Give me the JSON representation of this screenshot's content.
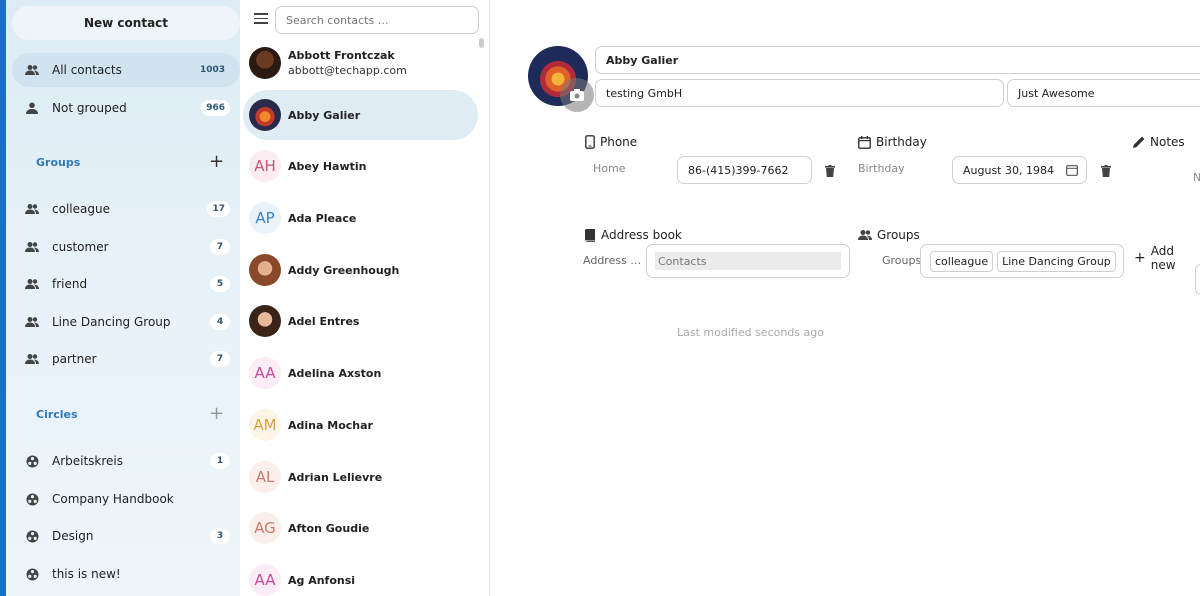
{
  "nav": {
    "new_contact": "New contact",
    "all_contacts": {
      "label": "All contacts",
      "count": "1003"
    },
    "not_grouped": {
      "label": "Not grouped",
      "count": "966"
    },
    "groups_title": "Groups",
    "groups": [
      {
        "label": "colleague",
        "count": "17"
      },
      {
        "label": "customer",
        "count": "7"
      },
      {
        "label": "friend",
        "count": "5"
      },
      {
        "label": "Line Dancing Group",
        "count": "4"
      },
      {
        "label": "partner",
        "count": "7"
      }
    ],
    "circles_title": "Circles",
    "circles": [
      {
        "label": "Arbeitskreis",
        "count": "1"
      },
      {
        "label": "Company Handbook",
        "count": ""
      },
      {
        "label": "Design",
        "count": "3"
      },
      {
        "label": "this is new!",
        "count": ""
      }
    ]
  },
  "list": {
    "search_placeholder": "Search contacts …",
    "contacts": [
      {
        "name": "Abbott Frontczak",
        "sub": "abbott@techapp.com",
        "initials": "",
        "photo": "dark"
      },
      {
        "name": "Abby Galier",
        "sub": "",
        "initials": "",
        "photo": "fire"
      },
      {
        "name": "Abey Hawtin",
        "sub": "",
        "initials": "AH",
        "color": "#c7567e",
        "bg": "#fbecf1"
      },
      {
        "name": "Ada Pleace",
        "sub": "",
        "initials": "AP",
        "color": "#3b82c4",
        "bg": "#eaf3fb"
      },
      {
        "name": "Addy Greenhough",
        "sub": "",
        "initials": "",
        "photo": "woman"
      },
      {
        "name": "Adel Entres",
        "sub": "",
        "initials": "",
        "photo": "woman2"
      },
      {
        "name": "Adelina Axston",
        "sub": "",
        "initials": "AA",
        "color": "#c04e9c",
        "bg": "#fbecf6"
      },
      {
        "name": "Adina Mochar",
        "sub": "",
        "initials": "AM",
        "color": "#d9a13a",
        "bg": "#fdf5e8"
      },
      {
        "name": "Adrian Lelievre",
        "sub": "",
        "initials": "AL",
        "color": "#c97a6a",
        "bg": "#fbefec"
      },
      {
        "name": "Afton Goudie",
        "sub": "",
        "initials": "AG",
        "color": "#c97a6a",
        "bg": "#fbefec"
      },
      {
        "name": "Ag Anfonsi",
        "sub": "",
        "initials": "AA",
        "color": "#c04e9c",
        "bg": "#fbecf6"
      }
    ]
  },
  "detail": {
    "name": "Abby Galier",
    "org": "testing GmbH",
    "title": "Just Awesome",
    "phone_title": "Phone",
    "phone_label": "Home",
    "phone_value": "86-(415)399-7662",
    "birthday_title": "Birthday",
    "birthday_label": "Birthday",
    "birthday_value": "August 30, 1984",
    "notes_title": "Notes",
    "notes_fragment": "N",
    "addressbook_title": "Address book",
    "addressbook_label": "Address …",
    "addressbook_value": "Contacts",
    "groups_title": "Groups",
    "groups_label": "Groups",
    "groups_tags": [
      "colleague",
      "Line Dancing Group"
    ],
    "add_new": "Add new",
    "modified": "Last modified seconds ago"
  }
}
